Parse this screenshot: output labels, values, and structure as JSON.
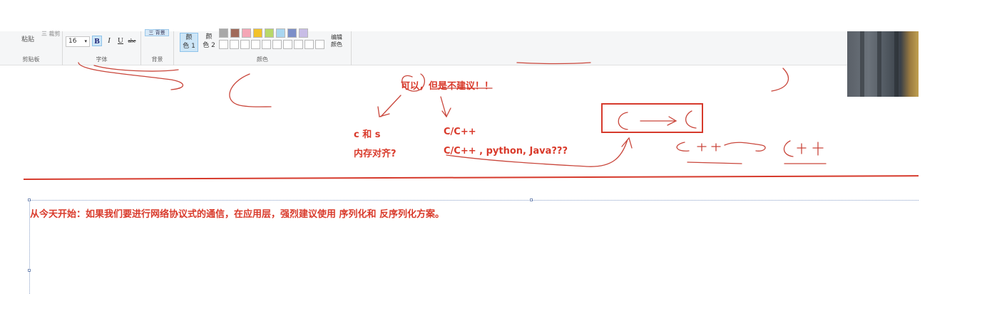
{
  "ribbon": {
    "clipboard": {
      "paste_label": "粘贴",
      "mini_label": "三 裁剪",
      "group_label": "剪贴板"
    },
    "font": {
      "size_value": "16",
      "bold_label": "B",
      "italic_label": "I",
      "underline_label": "U",
      "strike_label": "abe",
      "group_label": "字体"
    },
    "background": {
      "button_label": "三 背景",
      "group_label": "背景"
    },
    "colors": {
      "color1_label_top": "颜",
      "color1_label_bottom": "色 1",
      "color2_label_top": "颜",
      "color2_label_bottom": "色 2",
      "edit_label_top": "编辑",
      "edit_label_bottom": "颜色",
      "group_label": "颜色",
      "palette_row1": [
        "#a8a8a8",
        "#a06a5a",
        "#f4a6b6",
        "#f2c22b",
        "#b8d86a",
        "#a9d6f0",
        "#7c8fc8",
        "#c8bde6"
      ],
      "palette_row2": [
        "#ffffff",
        "#ffffff",
        "#ffffff",
        "#ffffff",
        "#ffffff",
        "#ffffff",
        "#ffffff",
        "#ffffff",
        "#ffffff",
        "#ffffff"
      ]
    }
  },
  "canvas": {
    "answer": "可以，但是不建议！！",
    "left_col_line1": "c 和 s",
    "left_col_line2": "内存对齐?",
    "right_col_line1": "C/C++",
    "right_col_line2": "C/C++ , python, Java???",
    "boxed_sketch": "C → C",
    "note": "从今天开始：如果我们要进行网络协议式的通信，在应用层，强烈建议使用 序列化和 反序列化方案。",
    "ink_color": "#d93a2b"
  },
  "webcam": {
    "description_icon": "webcam-feed"
  }
}
